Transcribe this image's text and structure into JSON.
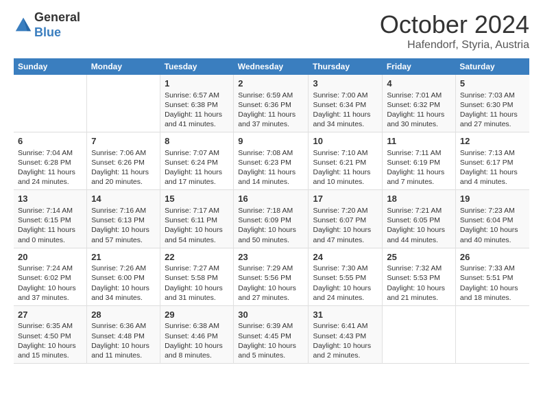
{
  "header": {
    "logo_line1": "General",
    "logo_line2": "Blue",
    "month": "October 2024",
    "location": "Hafendorf, Styria, Austria"
  },
  "days_of_week": [
    "Sunday",
    "Monday",
    "Tuesday",
    "Wednesday",
    "Thursday",
    "Friday",
    "Saturday"
  ],
  "weeks": [
    [
      {
        "day": "",
        "sunrise": "",
        "sunset": "",
        "daylight": ""
      },
      {
        "day": "",
        "sunrise": "",
        "sunset": "",
        "daylight": ""
      },
      {
        "day": "1",
        "sunrise": "Sunrise: 6:57 AM",
        "sunset": "Sunset: 6:38 PM",
        "daylight": "Daylight: 11 hours and 41 minutes."
      },
      {
        "day": "2",
        "sunrise": "Sunrise: 6:59 AM",
        "sunset": "Sunset: 6:36 PM",
        "daylight": "Daylight: 11 hours and 37 minutes."
      },
      {
        "day": "3",
        "sunrise": "Sunrise: 7:00 AM",
        "sunset": "Sunset: 6:34 PM",
        "daylight": "Daylight: 11 hours and 34 minutes."
      },
      {
        "day": "4",
        "sunrise": "Sunrise: 7:01 AM",
        "sunset": "Sunset: 6:32 PM",
        "daylight": "Daylight: 11 hours and 30 minutes."
      },
      {
        "day": "5",
        "sunrise": "Sunrise: 7:03 AM",
        "sunset": "Sunset: 6:30 PM",
        "daylight": "Daylight: 11 hours and 27 minutes."
      }
    ],
    [
      {
        "day": "6",
        "sunrise": "Sunrise: 7:04 AM",
        "sunset": "Sunset: 6:28 PM",
        "daylight": "Daylight: 11 hours and 24 minutes."
      },
      {
        "day": "7",
        "sunrise": "Sunrise: 7:06 AM",
        "sunset": "Sunset: 6:26 PM",
        "daylight": "Daylight: 11 hours and 20 minutes."
      },
      {
        "day": "8",
        "sunrise": "Sunrise: 7:07 AM",
        "sunset": "Sunset: 6:24 PM",
        "daylight": "Daylight: 11 hours and 17 minutes."
      },
      {
        "day": "9",
        "sunrise": "Sunrise: 7:08 AM",
        "sunset": "Sunset: 6:23 PM",
        "daylight": "Daylight: 11 hours and 14 minutes."
      },
      {
        "day": "10",
        "sunrise": "Sunrise: 7:10 AM",
        "sunset": "Sunset: 6:21 PM",
        "daylight": "Daylight: 11 hours and 10 minutes."
      },
      {
        "day": "11",
        "sunrise": "Sunrise: 7:11 AM",
        "sunset": "Sunset: 6:19 PM",
        "daylight": "Daylight: 11 hours and 7 minutes."
      },
      {
        "day": "12",
        "sunrise": "Sunrise: 7:13 AM",
        "sunset": "Sunset: 6:17 PM",
        "daylight": "Daylight: 11 hours and 4 minutes."
      }
    ],
    [
      {
        "day": "13",
        "sunrise": "Sunrise: 7:14 AM",
        "sunset": "Sunset: 6:15 PM",
        "daylight": "Daylight: 11 hours and 0 minutes."
      },
      {
        "day": "14",
        "sunrise": "Sunrise: 7:16 AM",
        "sunset": "Sunset: 6:13 PM",
        "daylight": "Daylight: 10 hours and 57 minutes."
      },
      {
        "day": "15",
        "sunrise": "Sunrise: 7:17 AM",
        "sunset": "Sunset: 6:11 PM",
        "daylight": "Daylight: 10 hours and 54 minutes."
      },
      {
        "day": "16",
        "sunrise": "Sunrise: 7:18 AM",
        "sunset": "Sunset: 6:09 PM",
        "daylight": "Daylight: 10 hours and 50 minutes."
      },
      {
        "day": "17",
        "sunrise": "Sunrise: 7:20 AM",
        "sunset": "Sunset: 6:07 PM",
        "daylight": "Daylight: 10 hours and 47 minutes."
      },
      {
        "day": "18",
        "sunrise": "Sunrise: 7:21 AM",
        "sunset": "Sunset: 6:05 PM",
        "daylight": "Daylight: 10 hours and 44 minutes."
      },
      {
        "day": "19",
        "sunrise": "Sunrise: 7:23 AM",
        "sunset": "Sunset: 6:04 PM",
        "daylight": "Daylight: 10 hours and 40 minutes."
      }
    ],
    [
      {
        "day": "20",
        "sunrise": "Sunrise: 7:24 AM",
        "sunset": "Sunset: 6:02 PM",
        "daylight": "Daylight: 10 hours and 37 minutes."
      },
      {
        "day": "21",
        "sunrise": "Sunrise: 7:26 AM",
        "sunset": "Sunset: 6:00 PM",
        "daylight": "Daylight: 10 hours and 34 minutes."
      },
      {
        "day": "22",
        "sunrise": "Sunrise: 7:27 AM",
        "sunset": "Sunset: 5:58 PM",
        "daylight": "Daylight: 10 hours and 31 minutes."
      },
      {
        "day": "23",
        "sunrise": "Sunrise: 7:29 AM",
        "sunset": "Sunset: 5:56 PM",
        "daylight": "Daylight: 10 hours and 27 minutes."
      },
      {
        "day": "24",
        "sunrise": "Sunrise: 7:30 AM",
        "sunset": "Sunset: 5:55 PM",
        "daylight": "Daylight: 10 hours and 24 minutes."
      },
      {
        "day": "25",
        "sunrise": "Sunrise: 7:32 AM",
        "sunset": "Sunset: 5:53 PM",
        "daylight": "Daylight: 10 hours and 21 minutes."
      },
      {
        "day": "26",
        "sunrise": "Sunrise: 7:33 AM",
        "sunset": "Sunset: 5:51 PM",
        "daylight": "Daylight: 10 hours and 18 minutes."
      }
    ],
    [
      {
        "day": "27",
        "sunrise": "Sunrise: 6:35 AM",
        "sunset": "Sunset: 4:50 PM",
        "daylight": "Daylight: 10 hours and 15 minutes."
      },
      {
        "day": "28",
        "sunrise": "Sunrise: 6:36 AM",
        "sunset": "Sunset: 4:48 PM",
        "daylight": "Daylight: 10 hours and 11 minutes."
      },
      {
        "day": "29",
        "sunrise": "Sunrise: 6:38 AM",
        "sunset": "Sunset: 4:46 PM",
        "daylight": "Daylight: 10 hours and 8 minutes."
      },
      {
        "day": "30",
        "sunrise": "Sunrise: 6:39 AM",
        "sunset": "Sunset: 4:45 PM",
        "daylight": "Daylight: 10 hours and 5 minutes."
      },
      {
        "day": "31",
        "sunrise": "Sunrise: 6:41 AM",
        "sunset": "Sunset: 4:43 PM",
        "daylight": "Daylight: 10 hours and 2 minutes."
      },
      {
        "day": "",
        "sunrise": "",
        "sunset": "",
        "daylight": ""
      },
      {
        "day": "",
        "sunrise": "",
        "sunset": "",
        "daylight": ""
      }
    ]
  ]
}
